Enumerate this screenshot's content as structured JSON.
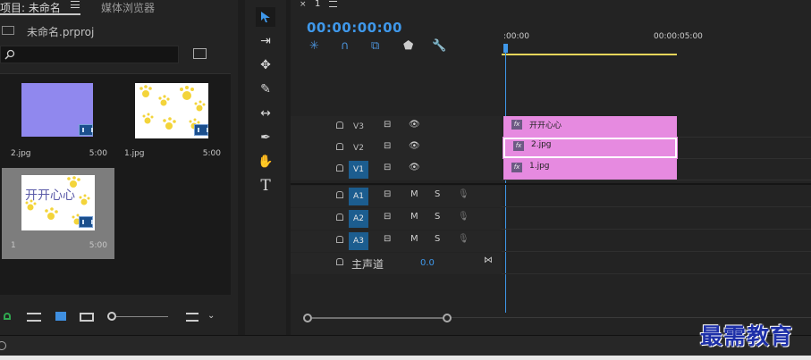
{
  "project_panel": {
    "tabs": [
      {
        "label": "项目: 未命名"
      },
      {
        "label": "媒体浏览器"
      }
    ],
    "tab_menu_icon": "hamburger-icon",
    "project_file": "未命名.prproj",
    "search_placeholder": "",
    "items": [
      {
        "name": "2.jpg",
        "duration": "5:00",
        "thumb": "purple",
        "selected": false
      },
      {
        "name": "1.jpg",
        "duration": "5:00",
        "thumb": "paws",
        "selected": false
      },
      {
        "name": "1",
        "duration": "5:00",
        "thumb": "paws-text",
        "overlay_text": "开开心心",
        "selected": true
      }
    ]
  },
  "tools": [
    "selection-tool",
    "track-select-tool",
    "ripple-edit-tool",
    "razor-tool",
    "slip-tool",
    "pen-tool",
    "hand-tool",
    "type-tool"
  ],
  "timeline": {
    "tab_label": "1",
    "timecode": "00:00:00:00",
    "ruler": {
      "start": ":00:00",
      "mark": "00:00:05:00"
    },
    "video_tracks": [
      {
        "label": "V3",
        "active": false,
        "clip": {
          "name": "开开心心",
          "fx": "fx"
        }
      },
      {
        "label": "V2",
        "active": false,
        "clip": {
          "name": "2.jpg",
          "fx": "fx"
        }
      },
      {
        "label": "V1",
        "active": true,
        "clip": {
          "name": "1.jpg",
          "fx": "fx"
        }
      }
    ],
    "audio_tracks": [
      {
        "label": "A1",
        "mute": "M",
        "solo": "S"
      },
      {
        "label": "A2",
        "mute": "M",
        "solo": "S"
      },
      {
        "label": "A3",
        "mute": "M",
        "solo": "S"
      }
    ],
    "master": {
      "label": "主声道",
      "value": "0.0"
    }
  },
  "watermark": {
    "text": "最需教育"
  },
  "colors": {
    "accent": "#3f98ea",
    "clip": "#e68ae0",
    "track_active": "#1c5d8f"
  }
}
